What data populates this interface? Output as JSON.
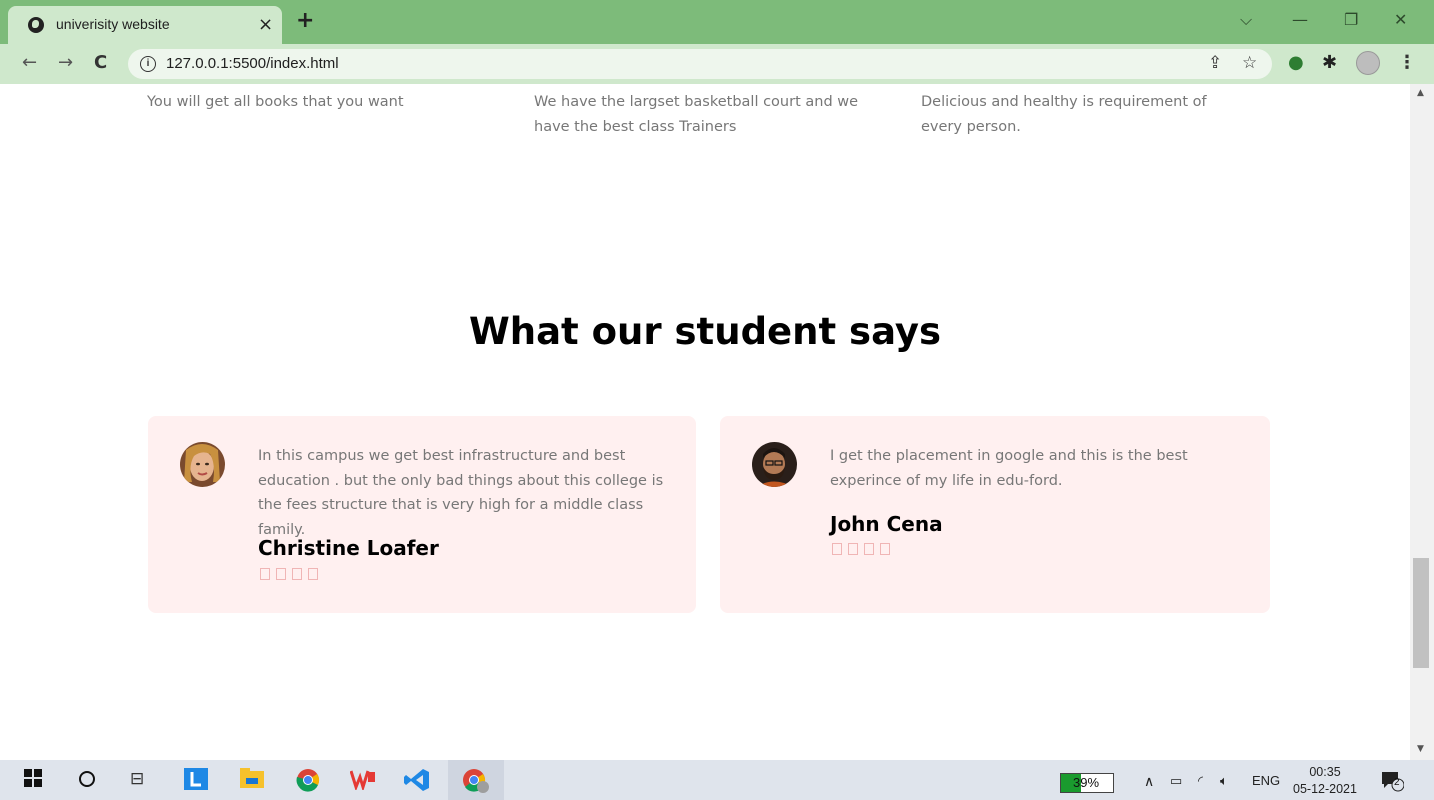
{
  "browser": {
    "tab_title": "univerisity website",
    "tab_close": "×",
    "new_tab": "+",
    "url": "127.0.0.1:5500/index.html",
    "window_controls": {
      "chevron": "⌵",
      "minimize": "—",
      "restore": "❐",
      "close": "✕"
    }
  },
  "features": [
    {
      "text": "You will get all books that you want"
    },
    {
      "text": "We have the largset basketball court and we have the best class Trainers"
    },
    {
      "text": "Delicious and healthy is requirement of every person."
    }
  ],
  "testimonials": {
    "heading": "What our student says",
    "items": [
      {
        "quote": "In this campus we get best infrastructure and best education . but the only bad things about this college is the fees structure that is very high for a middle class family.",
        "name": "Christine Loafer",
        "rating_icons": 4
      },
      {
        "quote": "I get the placement in google and this is the best experince of my life in edu-ford.",
        "name": "John Cena",
        "rating_icons": 4
      }
    ]
  },
  "taskbar": {
    "battery_text": "39%",
    "battery_level": 0.39,
    "language": "ENG",
    "time": "00:35",
    "date": "05-12-2021",
    "notification_count": "2"
  },
  "colors": {
    "tab_bar": "#7dbb7a",
    "toolbar": "#cfe8cc",
    "card_background": "#fff0f0",
    "battery": "#1a9b2e"
  }
}
